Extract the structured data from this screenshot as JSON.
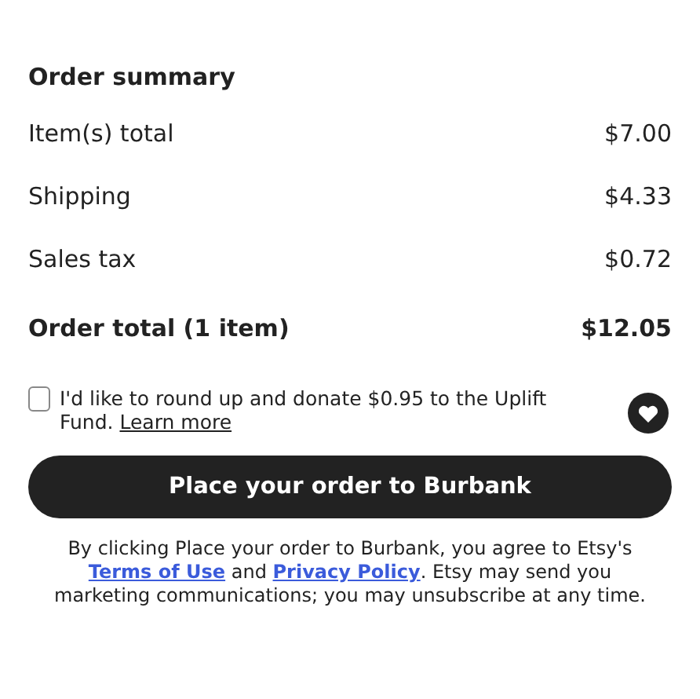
{
  "heading": "Order summary",
  "rows": [
    {
      "label": "Item(s) total",
      "value": "$7.00",
      "kind": "line"
    },
    {
      "label": "Shipping",
      "value": "$4.33",
      "kind": "line"
    },
    {
      "label": "Sales tax",
      "value": "$0.72",
      "kind": "line"
    },
    {
      "label": "Order total (1 item)",
      "value": "$12.05",
      "kind": "total"
    }
  ],
  "donation": {
    "checked": false,
    "text": "I'd like to round up and donate $0.95 to the Uplift Fund.",
    "link": "Learn more"
  },
  "button": "Place your order to Burbank",
  "disclaimer": [
    {
      "kind": "text",
      "text": "By clicking Place your order to Burbank, you agree to Etsy's "
    },
    {
      "kind": "link",
      "text": "Terms of Use"
    },
    {
      "kind": "text",
      "text": " and "
    },
    {
      "kind": "link",
      "text": "Privacy Policy"
    },
    {
      "kind": "text",
      "text": ". Etsy may send you marketing communications; you may unsubscribe at any time."
    }
  ]
}
